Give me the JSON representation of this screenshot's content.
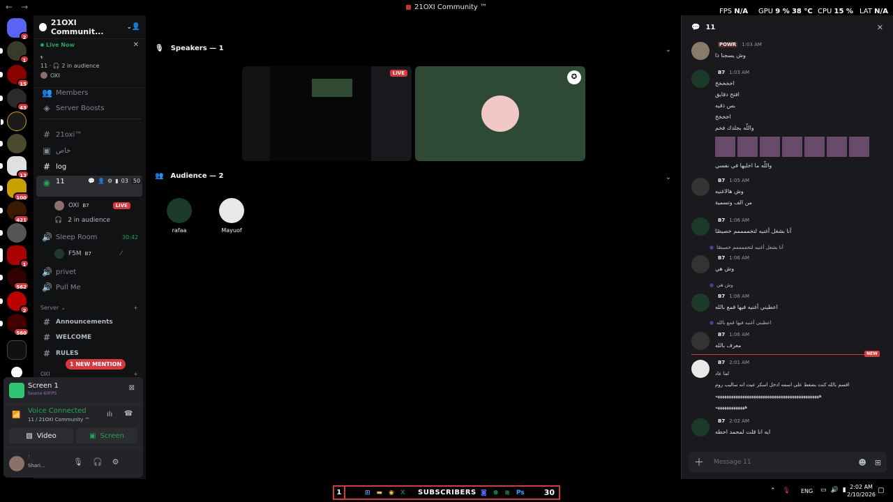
{
  "titlebar": {
    "title": "21OXI Community ™",
    "nav_back": "←",
    "nav_fwd": "→"
  },
  "overlay": {
    "fps_label": "FPS",
    "fps_value": "N/A",
    "gpu_label": "GPU",
    "gpu_value": "9 %",
    "gpu_temp": "38 °C",
    "cpu_label": "CPU",
    "cpu_value": "15 %",
    "lat_label": "LAT",
    "lat_value": "N/A"
  },
  "servers": [
    {
      "badge": "2",
      "color": "#5865f2"
    },
    {
      "badge": "1",
      "color": "#3a3a2a"
    },
    {
      "badge": "15",
      "color": "#8b0000"
    },
    {
      "badge": "43",
      "color": "#2a2a2a"
    },
    {
      "badge": "",
      "color": "#1a1a1a"
    },
    {
      "badge": "",
      "color": "#4a4a30"
    },
    {
      "badge": "13",
      "color": "#e0e0e0"
    },
    {
      "badge": "100",
      "color": "#c8a000"
    },
    {
      "badge": "421",
      "color": "#3a1a00"
    },
    {
      "badge": "",
      "color": "#555"
    },
    {
      "badge": "1",
      "color": "#a00"
    },
    {
      "badge": "562",
      "color": "#300"
    },
    {
      "badge": "2",
      "color": "#b00"
    },
    {
      "badge": "560",
      "color": "#400"
    }
  ],
  "server_name": "21OXI Communit...",
  "live_now": {
    "label": "Live Now",
    "channel_icon": "ﮩ",
    "stats": "11 · 🎧 2 in audience",
    "user": "OXI"
  },
  "channels": [
    {
      "label": "Members",
      "icon": "👥"
    },
    {
      "label": "Server Boosts",
      "icon": "◈"
    },
    {
      "label": "21oxi™",
      "icon": "#"
    },
    {
      "label": "خاص",
      "icon": "▣"
    },
    {
      "label": "log",
      "icon": "#"
    },
    {
      "label": "11",
      "icon": "◉",
      "count": "03",
      "limit": "50"
    },
    {
      "label": "Sleep Room",
      "icon": "🔊",
      "timer": "30:42"
    },
    {
      "label": "privet",
      "icon": "🔊"
    },
    {
      "label": "Pull Me",
      "icon": "🔊"
    },
    {
      "label": "Announcements",
      "icon": "#"
    },
    {
      "label": "WELCOME",
      "icon": "#"
    },
    {
      "label": "RULES",
      "icon": "#"
    }
  ],
  "voice_users": {
    "oxi": {
      "name": "OXI",
      "tag": "B7",
      "live": "LIVE"
    },
    "audience": "2 in audience",
    "f5m": {
      "name": "F5M",
      "tag": "B7"
    }
  },
  "server_category": "Server",
  "oxi_category": "OXI",
  "new_mention": "1 NEW MENTION",
  "userpanel": {
    "screen_title": "Screen 1",
    "screen_sub": "Source 60FPS",
    "voice_status": "Voice Connected",
    "voice_sub": "11 / 21OXI Community ™",
    "video_label": "Video",
    "screen_label": "Screen",
    "user_status": "Shari..."
  },
  "stage": {
    "speakers_label": "Speakers — 1",
    "audience_label": "Audience — 2",
    "live_badge": "LIVE",
    "audience": [
      {
        "name": "rafaa"
      },
      {
        "name": "Mayuof"
      }
    ]
  },
  "chat": {
    "channel": "11",
    "input_placeholder": "Message 11",
    "new_label": "NEW",
    "messages": [
      {
        "name": "",
        "tag": "POWR",
        "time": "1:03 AM",
        "lines": [
          "وش يسجنا ذا"
        ]
      },
      {
        "name": "",
        "tag": "B7",
        "time": "1:03 AM",
        "lines": [
          "اخخخخخ",
          "افتح دقايق",
          "بس ذقيه",
          "اخخخخ",
          "واللّه بجلدك فخم"
        ],
        "after_images": "واللّه ما اخليها في نفسي"
      },
      {
        "name": "",
        "tag": "B7",
        "time": "1:05 AM",
        "lines": [
          "وش هالاغنيه",
          "من الف وتسمية"
        ]
      },
      {
        "name": "",
        "tag": "B7",
        "time": "1:06 AM",
        "lines": [
          "أنا بشغل أغنيه لتخممممم خصيصًا"
        ]
      },
      {
        "reply": "أنا بشغل أغنيه لتخممممم خصيصًا",
        "name": "",
        "tag": "B7",
        "time": "1:06 AM",
        "lines": [
          "وش هي"
        ]
      },
      {
        "reply": "وش هي",
        "name": "",
        "tag": "B7",
        "time": "1:06 AM",
        "lines": [
          "اعطيني أغنيه فيها قمع بالله"
        ]
      },
      {
        "reply": "اعطيني أغنيه فيها قمع بالله",
        "name": "",
        "tag": "B7",
        "time": "1:06 AM",
        "lines": [
          "معرف بالله"
        ]
      },
      {
        "name": "",
        "tag": "B7",
        "time": "2:01 AM",
        "lines": [
          "لما عاد",
          "اقسم بالله كنت بضغط على اسمه ادخل اسكر عيت انه ساليب روم",
          "ههههههههههههههههههههههههههههههههههههههههههههههه",
          "هههههههههههههه"
        ]
      },
      {
        "name": "",
        "tag": "B7",
        "time": "2:02 AM",
        "lines": [
          "ايه انا قلت لمحمد احطه"
        ]
      }
    ]
  },
  "taskbar": {
    "sub_count_left": "1",
    "sub_label": "SUBSCRIBERS",
    "sub_count_right": "30",
    "lang": "ENG",
    "time": "2:02 AM",
    "date": "2/10/2026"
  }
}
